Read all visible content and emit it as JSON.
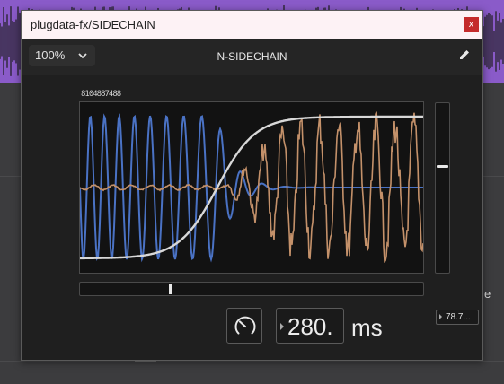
{
  "window": {
    "title": "plugdata-fx/SIDECHAIN",
    "close_label": "x"
  },
  "toolbar": {
    "zoom_value": "100%",
    "patch_name": "N-SIDECHAIN",
    "icons": [
      "chevron-down-icon",
      "pencil-icon"
    ]
  },
  "scope": {
    "overlay_label": "8104887488"
  },
  "controls": {
    "vertical_slider_level": 0.37,
    "horizontal_slider_level": 0.26,
    "time_value": "280.",
    "time_unit": "ms",
    "mini_value": "78.7...",
    "knob_icon": "knob-gauge-icon"
  },
  "host": {
    "edge_letter": "e"
  },
  "colors": {
    "host_accent": "#8a5bc9",
    "wave_blue": "#4a72c4",
    "wave_orange": "#c4916a",
    "envelope": "#d8d8d8",
    "close_button": "#c42b2b"
  }
}
